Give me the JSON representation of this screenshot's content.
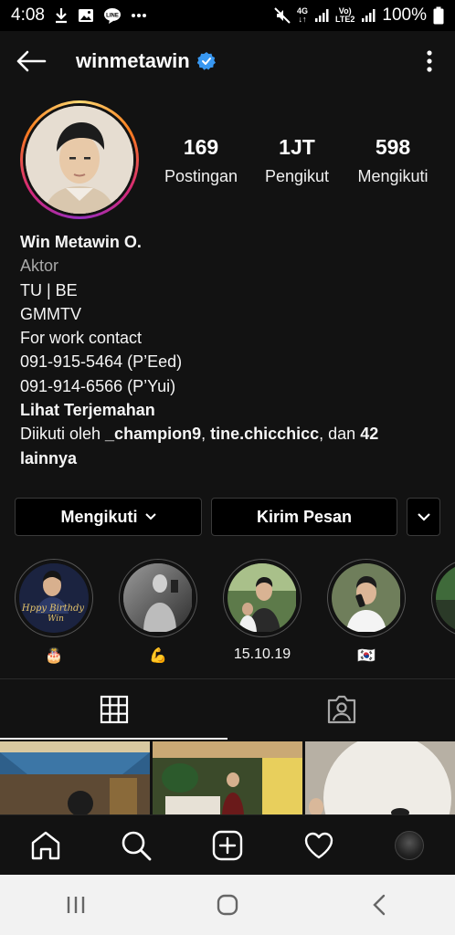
{
  "status_bar": {
    "time": "4:08",
    "network_top": "4G",
    "network_volte": "Vo)",
    "network_lte": "LTE2",
    "battery": "100%"
  },
  "header": {
    "username": "winmetawin",
    "back_icon": "arrow-left-icon",
    "verified_icon": "verified-badge-icon",
    "menu_icon": "more-vertical-icon"
  },
  "stats": [
    {
      "value": "169",
      "label": "Postingan"
    },
    {
      "value": "1JT",
      "label": "Pengikut"
    },
    {
      "value": "598",
      "label": "Mengikuti"
    }
  ],
  "bio": {
    "name": "Win Metawin O.",
    "category": "Aktor",
    "lines": [
      "TU | BE",
      "GMMTV",
      "For work contact",
      "091-915-5464 (P’Eed)",
      "091-914-6566 (P’Yui)"
    ],
    "translate": "Lihat Terjemahan",
    "followed_prefix": "Diikuti oleh ",
    "followed_user1": "_champion9",
    "followed_sep": ", ",
    "followed_user2": "tine.chicchicc",
    "followed_and": ", dan ",
    "followed_count": "42",
    "followed_others": "lainnya"
  },
  "actions": {
    "follow": "Mengikuti",
    "message": "Kirim Pesan"
  },
  "highlights": [
    {
      "label": "🎂"
    },
    {
      "label": "💪"
    },
    {
      "label": "15.10.19"
    },
    {
      "label": "🇰🇷"
    },
    {
      "label": ""
    }
  ],
  "colors": {
    "background": "#121212",
    "verified": "#3897f0",
    "secondary_text": "#a8a8a8"
  }
}
